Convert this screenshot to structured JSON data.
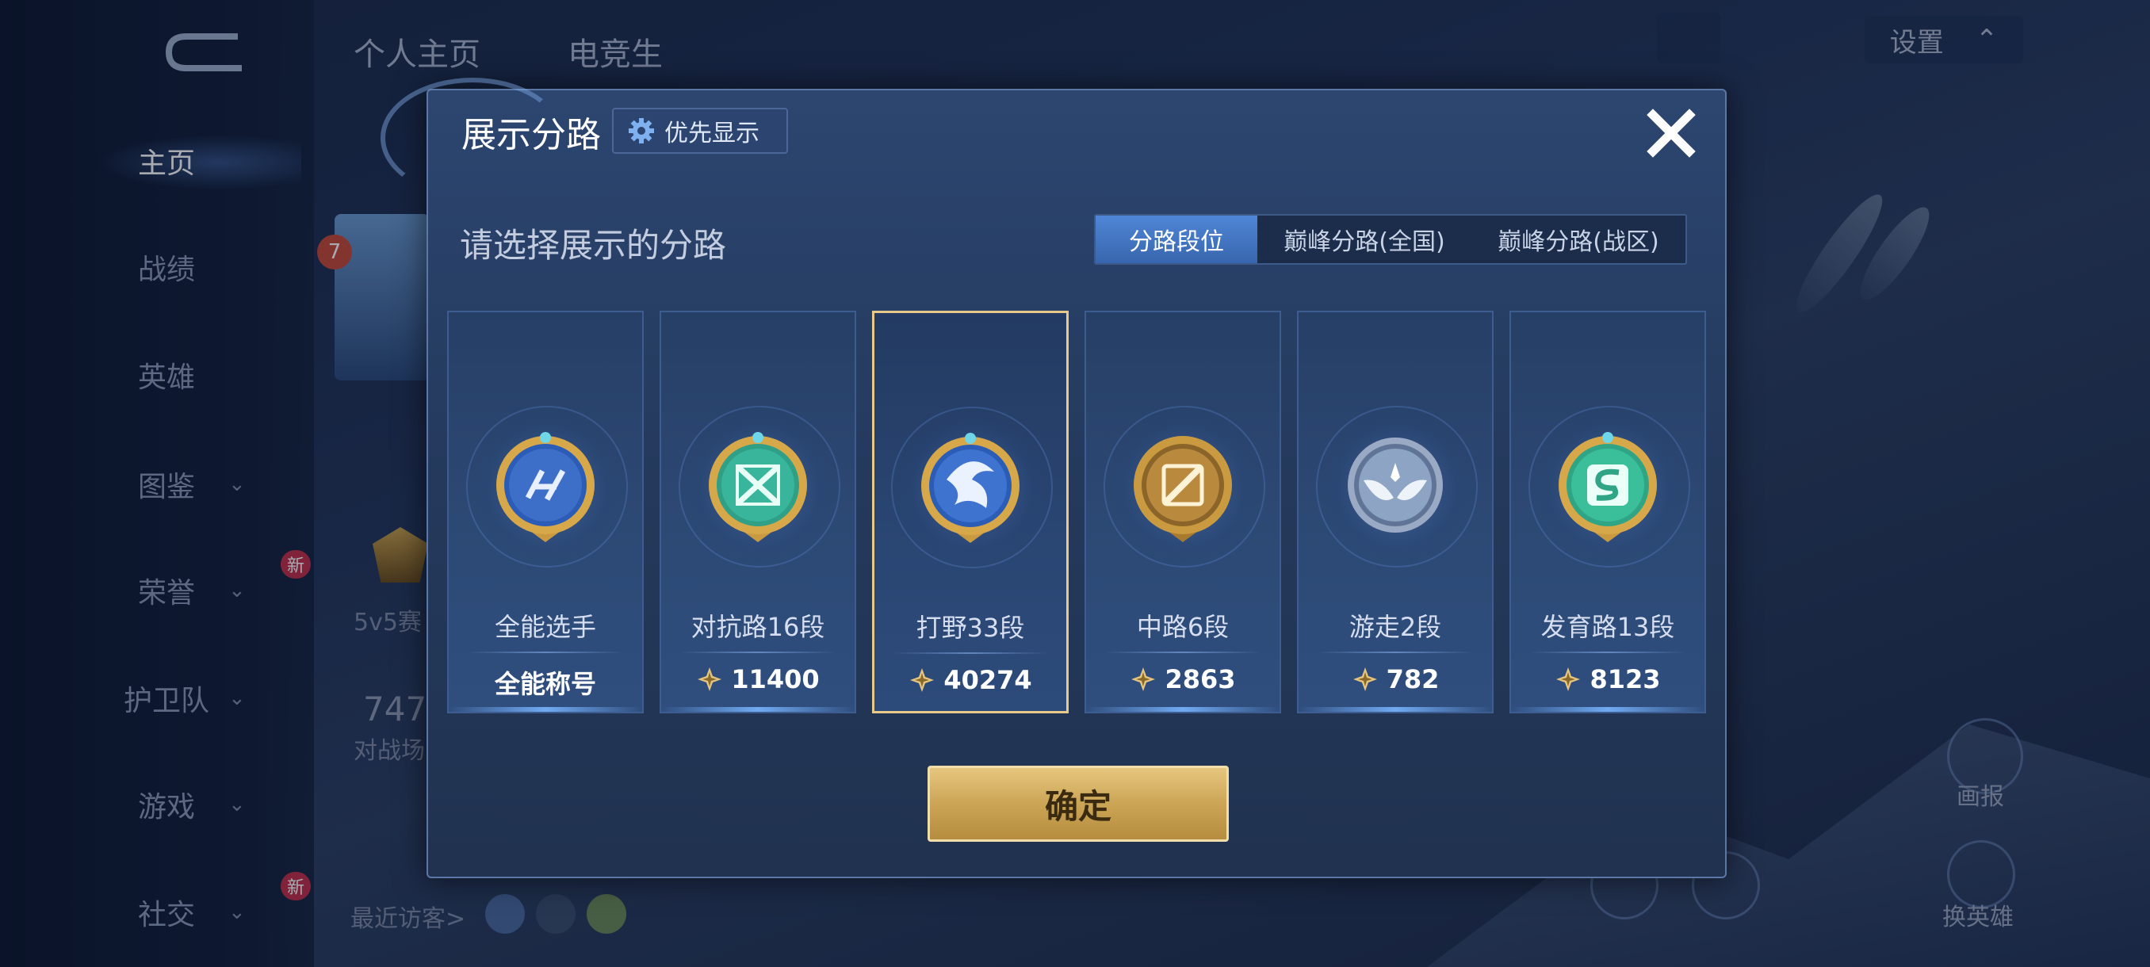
{
  "sidebar": {
    "items": [
      {
        "label": "主页",
        "has_chevron": false,
        "new": false
      },
      {
        "label": "战绩",
        "has_chevron": false,
        "new": false
      },
      {
        "label": "英雄",
        "has_chevron": false,
        "new": false
      },
      {
        "label": "图鉴",
        "has_chevron": true,
        "new": false
      },
      {
        "label": "荣誉",
        "has_chevron": true,
        "new": true
      },
      {
        "label": "护卫队",
        "has_chevron": true,
        "new": false
      },
      {
        "label": "游戏",
        "has_chevron": true,
        "new": false
      },
      {
        "label": "社交",
        "has_chevron": true,
        "new": true
      }
    ],
    "new_badge": "新"
  },
  "background": {
    "tabs": [
      "个人主页",
      "电竞生"
    ],
    "settings_label": "设置",
    "level": "7",
    "mode_text": "5v5赛",
    "number_text": "747",
    "stat_text": "对战场",
    "recent_visitors": "最近访客>",
    "right_buttons": [
      "画报",
      "换英雄"
    ]
  },
  "dialog": {
    "title": "展示分路",
    "priority_label": "优先显示",
    "prompt": "请选择展示的分路",
    "tabs": [
      "分路段位",
      "巅峰分路(全国)",
      "巅峰分路(战区)"
    ],
    "active_tab": 0,
    "cards": [
      {
        "title": "全能选手",
        "value": "全能称号",
        "has_star": false,
        "emblem": "allround-emblem-icon",
        "color": "#3d6fc8"
      },
      {
        "title": "对抗路16段",
        "value": "11400",
        "has_star": true,
        "emblem": "clash-lane-emblem-icon",
        "color": "#39b59b"
      },
      {
        "title": "打野33段",
        "value": "40274",
        "has_star": true,
        "emblem": "jungle-emblem-icon",
        "color": "#3f73d0",
        "selected": true
      },
      {
        "title": "中路6段",
        "value": "2863",
        "has_star": true,
        "emblem": "mid-lane-emblem-icon",
        "color": "#b98a3e"
      },
      {
        "title": "游走2段",
        "value": "782",
        "has_star": true,
        "emblem": "roam-emblem-icon",
        "color": "#8ea4c4"
      },
      {
        "title": "发育路13段",
        "value": "8123",
        "has_star": true,
        "emblem": "farm-lane-emblem-icon",
        "color": "#3bbf9a"
      }
    ],
    "confirm_label": "确定"
  },
  "colors": {
    "accent_gold": "#e9c98a",
    "tab_active": "#4f86d6",
    "dialog_bg": "#24395c"
  }
}
